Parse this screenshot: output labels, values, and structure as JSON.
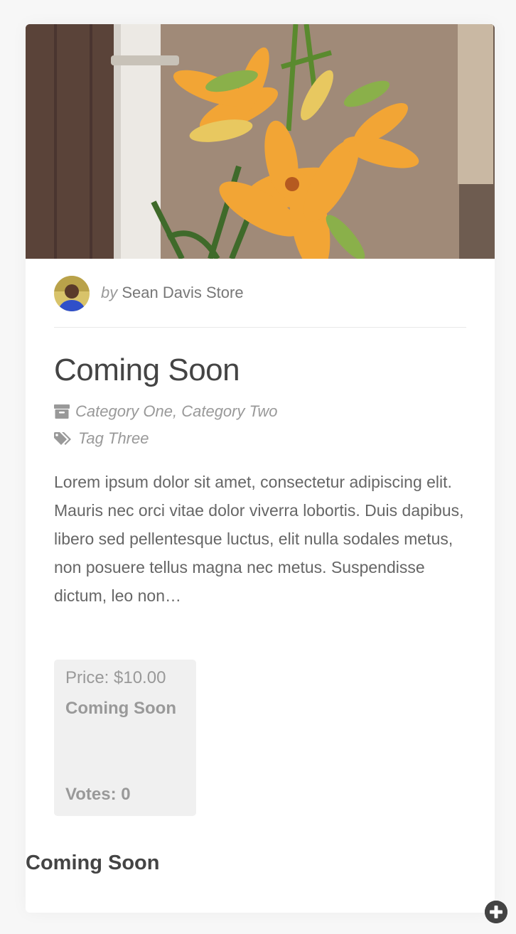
{
  "card": {
    "hero_image": "orange-lily-flowers-photo",
    "author": {
      "by_label": "by",
      "name": "Sean Davis Store",
      "avatar": "avatar-photo"
    },
    "title": "Coming Soon",
    "categories": [
      "Category One",
      "Category Two"
    ],
    "category_separator": ",",
    "category_icon": "archive-icon",
    "tags": [
      "Tag Three"
    ],
    "tag_icon": "tags-icon",
    "excerpt": "Lorem ipsum dolor sit amet, consectetur adipiscing elit. Mauris nec orci vitae dolor viverra lobortis. Duis dapibus, libero sed pellentesque luctus, elit nulla sodales metus, non posuere tellus magna nec metus. Suspendisse dictum, leo non…",
    "vote_box": {
      "price": "Price: $10.00",
      "status": "Coming Soon",
      "votes": "Votes: 0"
    },
    "footer_label": "Coming Soon"
  },
  "floating_button_icon": "plus-circle-icon",
  "colors": {
    "page_bg": "#f7f7f7",
    "card_bg": "#ffffff",
    "vote_box_bg": "#f0f0f0",
    "title_text": "#444444",
    "meta_text": "#999999"
  }
}
